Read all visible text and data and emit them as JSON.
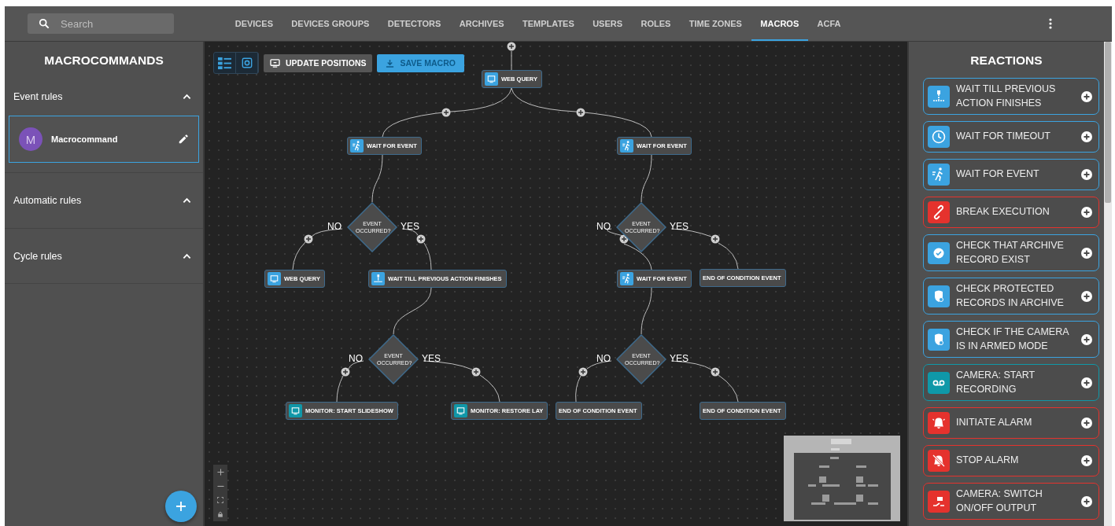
{
  "top_bar": {
    "search": {
      "placeholder": "Search"
    },
    "tabs": [
      {
        "label": "DEVICES",
        "selected": false
      },
      {
        "label": "DEVICES GROUPS",
        "selected": false
      },
      {
        "label": "DETECTORS",
        "selected": false
      },
      {
        "label": "ARCHIVES",
        "selected": false
      },
      {
        "label": "TEMPLATES",
        "selected": false
      },
      {
        "label": "USERS",
        "selected": false
      },
      {
        "label": "ROLES",
        "selected": false
      },
      {
        "label": "TIME ZONES",
        "selected": false
      },
      {
        "label": "MACROS",
        "selected": true
      },
      {
        "label": "ACFA",
        "selected": false
      }
    ]
  },
  "macrocommands": {
    "title": "MACROCOMMANDS",
    "sections": [
      {
        "title": "Event rules",
        "expanded": true,
        "items": [
          {
            "avatar": "M",
            "name": "Macrocommand",
            "selected": true
          }
        ]
      },
      {
        "title": "Automatic rules",
        "expanded": true
      },
      {
        "title": "Cycle rules",
        "expanded": true
      }
    ]
  },
  "editor": {
    "update_button": "UPDATE POSITIONS",
    "save_button": "SAVE MACRO",
    "nodes": [
      {
        "kind": "web_query",
        "label": "WEB QUERY"
      },
      {
        "kind": "wait_event",
        "label": "WAIT FOR EVENT"
      },
      {
        "kind": "wait_event",
        "label": "WAIT FOR EVENT"
      },
      {
        "kind": "condition",
        "label": "EVENT OCCURRED?",
        "no_label": "NO",
        "yes_label": "YES"
      },
      {
        "kind": "condition",
        "label": "EVENT OCCURRED?",
        "no_label": "NO",
        "yes_label": "YES"
      },
      {
        "kind": "web_query",
        "label": "WEB QUERY"
      },
      {
        "kind": "wait_previous",
        "label": "WAIT TILL PREVIOUS ACTION FINISHES"
      },
      {
        "kind": "wait_event",
        "label": "WAIT FOR EVENT"
      },
      {
        "kind": "end",
        "label": "END OF CONDITION EVENT"
      },
      {
        "kind": "condition",
        "label": "EVENT OCCURRED?",
        "no_label": "NO",
        "yes_label": "YES"
      },
      {
        "kind": "condition",
        "label": "EVENT OCCURRED?",
        "no_label": "NO",
        "yes_label": "YES"
      },
      {
        "kind": "monitor",
        "label": "MONITOR: START SLIDESHOW"
      },
      {
        "kind": "monitor",
        "label": "MONITOR: RESTORE LAY"
      },
      {
        "kind": "end",
        "label": "END OF CONDITION EVENT"
      },
      {
        "kind": "end",
        "label": "END OF CONDITION EVENT"
      }
    ]
  },
  "reactions": {
    "title": "REACTIONS",
    "items": [
      {
        "kind": "wait_previous",
        "label": "WAIT TILL PREVIOUS ACTION FINISHES",
        "color": "#3ba3e0"
      },
      {
        "kind": "timeout",
        "label": "WAIT FOR TIMEOUT",
        "color": "#3ba3e0"
      },
      {
        "kind": "wait_event",
        "label": "WAIT FOR EVENT",
        "color": "#3ba3e0"
      },
      {
        "kind": "break",
        "label": "BREAK EXECUTION",
        "color": "#e5322d"
      },
      {
        "kind": "archive_check",
        "label": "CHECK THAT ARCHIVE RECORD EXIST",
        "color": "#3ba3e0"
      },
      {
        "kind": "protected_check",
        "label": "CHECK PROTECTED RECORDS IN ARCHIVE",
        "color": "#3ba3e0"
      },
      {
        "kind": "camera_armed",
        "label": "CHECK IF THE CAMERA IS IN ARMED MODE",
        "color": "#3ba3e0"
      },
      {
        "kind": "recording",
        "label": "CAMERA: START RECORDING",
        "color": "#0f98a8"
      },
      {
        "kind": "alarm_on",
        "label": "INITIATE ALARM",
        "color": "#e5322d"
      },
      {
        "kind": "alarm_off",
        "label": "STOP ALARM",
        "color": "#e5322d"
      },
      {
        "kind": "output",
        "label": "CAMERA: SWITCH ON/OFF OUTPUT",
        "color": "#e5322d"
      }
    ]
  }
}
